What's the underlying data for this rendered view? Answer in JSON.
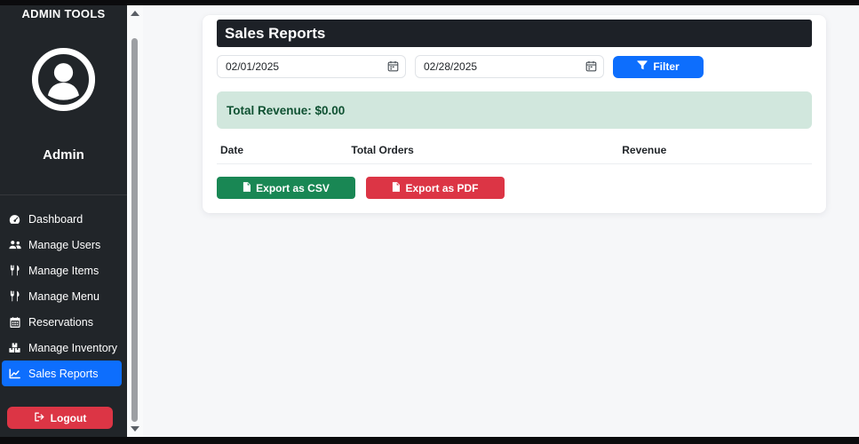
{
  "sidebar": {
    "title": "ADMIN TOOLS",
    "user_name": "Admin",
    "items": [
      {
        "label": "Dashboard",
        "icon": "tachometer-icon",
        "active": false
      },
      {
        "label": "Manage Users",
        "icon": "users-icon",
        "active": false
      },
      {
        "label": "Manage Items",
        "icon": "utensils-icon",
        "active": false
      },
      {
        "label": "Manage Menu",
        "icon": "utensils-icon",
        "active": false
      },
      {
        "label": "Reservations",
        "icon": "calendar-icon",
        "active": false
      },
      {
        "label": "Manage Inventory",
        "icon": "boxes-icon",
        "active": false
      },
      {
        "label": "Sales Reports",
        "icon": "chart-line-icon",
        "active": true
      }
    ],
    "logout_label": "Logout",
    "logout_icon": "sign-out-icon",
    "avatar_icon": "user-circle-icon"
  },
  "main": {
    "title": "Sales Reports",
    "filters": {
      "start_date": "02/01/2025",
      "end_date": "02/28/2025",
      "date_icon": "calendar-icon",
      "filter_button_label": "Filter",
      "filter_button_icon": "funnel-icon"
    },
    "summary": {
      "total_revenue_text": "Total Revenue: $0.00"
    },
    "table": {
      "headers": [
        "Date",
        "Total Orders",
        "Revenue"
      ],
      "rows": []
    },
    "export": {
      "csv_label": "Export as CSV",
      "csv_icon": "file-csv-icon",
      "pdf_label": "Export as PDF",
      "pdf_icon": "file-pdf-icon"
    }
  },
  "colors": {
    "accent_blue": "#0d6efd",
    "success_green": "#198754",
    "danger_red": "#dc3545",
    "alert_bg": "#d1e7dd",
    "alert_text": "#0f5132",
    "sidebar_bg": "#212529",
    "card_header_bg": "#1d2127",
    "page_bg": "#f6f7f9"
  }
}
